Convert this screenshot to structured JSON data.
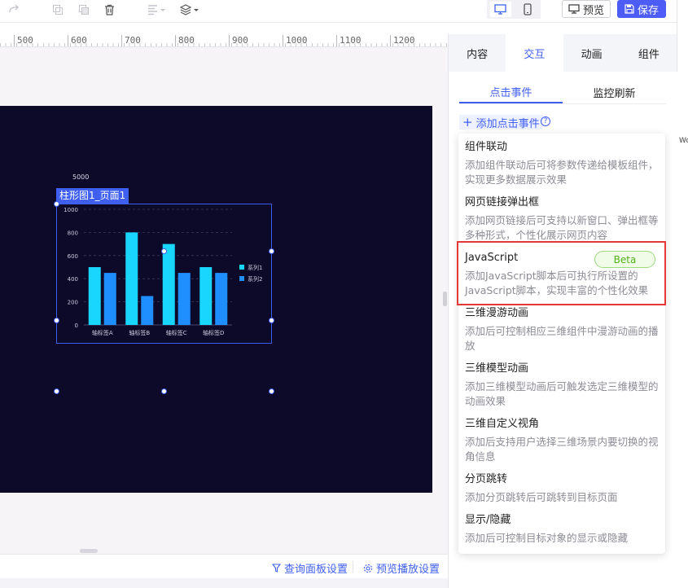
{
  "toolbar": {
    "preview_label": "预览",
    "save_label": "保存"
  },
  "ruler": {
    "labels": [
      "500",
      "600",
      "700",
      "800",
      "900",
      "1000",
      "1100",
      "1200"
    ]
  },
  "widget": {
    "tag": "柱形图1_页面1",
    "top_label": "5000"
  },
  "chart_data": {
    "type": "bar",
    "categories": [
      "轴标签A",
      "轴标签B",
      "轴标签C",
      "轴标签D"
    ],
    "series": [
      {
        "name": "系列1",
        "values": [
          500,
          800,
          700,
          500
        ],
        "color": "#19d6ff"
      },
      {
        "name": "系列2",
        "values": [
          450,
          250,
          450,
          450
        ],
        "color": "#1f8fff"
      }
    ],
    "yticks": [
      0,
      200,
      400,
      600,
      800,
      1000
    ],
    "ylim": [
      0,
      1000
    ],
    "grid": true,
    "legend": "right"
  },
  "bottom": {
    "query_settings": "查询面板设置",
    "preview_settings": "预览播放设置"
  },
  "panel": {
    "tabs": [
      "内容",
      "交互",
      "动画",
      "组件"
    ],
    "active_tab": "交互",
    "sub_tabs": [
      "点击事件",
      "监控刷新"
    ],
    "add_event": "添加点击事件"
  },
  "menu": [
    {
      "title": "组件联动",
      "desc": "添加组件联动后可将参数传递给模板组件，实现更多数据展示效果"
    },
    {
      "title": "网页链接弹出框",
      "desc": "添加网页链接后可支持以新窗口、弹出框等多种形式，个性化展示网页内容"
    },
    {
      "title": "JavaScript",
      "desc": "添加JavaScript脚本后可执行所设置的JavaScript脚本，实现丰富的个性化效果",
      "badge": "Beta"
    },
    {
      "title": "三维漫游动画",
      "desc": "添加后可控制相应三维组件中漫游动画的播放"
    },
    {
      "title": "三维模型动画",
      "desc": "添加三维模型动画后可触发选定三维模型的动画效果"
    },
    {
      "title": "三维自定义视角",
      "desc": "添加后支持用户选择三维场景内要切换的视角信息"
    },
    {
      "title": "分页跳转",
      "desc": "添加分页跳转后可跳转到目标页面"
    },
    {
      "title": "显示/隐藏",
      "desc": "添加后可控制目标对象的显示或隐藏"
    }
  ]
}
